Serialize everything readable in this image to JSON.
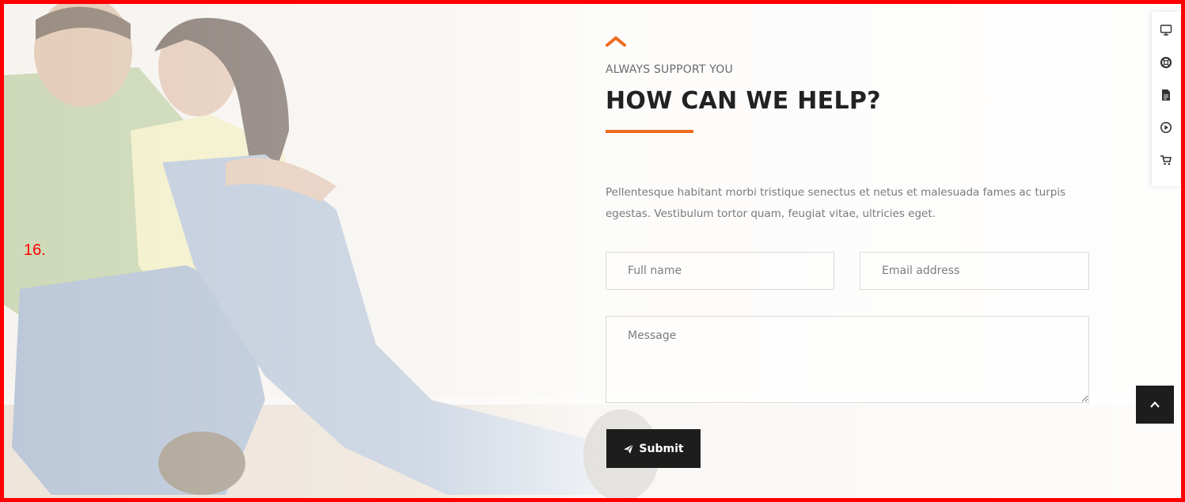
{
  "annotation": {
    "label": "16."
  },
  "section": {
    "eyebrow": "ALWAYS SUPPORT YOU",
    "title": "HOW CAN WE HELP?",
    "description": "Pellentesque habitant morbi tristique senectus et netus et malesuada fames ac turpis egestas. Vestibulum tortor quam, feugiat vitae, ultricies eget."
  },
  "form": {
    "name_placeholder": "Full name",
    "email_placeholder": "Email address",
    "message_placeholder": "Message",
    "submit_label": "Submit"
  },
  "toolbar": {
    "icons": [
      "monitor-icon",
      "lifebuoy-icon",
      "document-icon",
      "play-circle-icon",
      "cart-icon"
    ]
  },
  "back_to_top": {
    "icon": "chevron-up-icon"
  },
  "colors": {
    "accent": "#ef6c20",
    "dark": "#1d1d1d",
    "frame": "#ff0000"
  }
}
